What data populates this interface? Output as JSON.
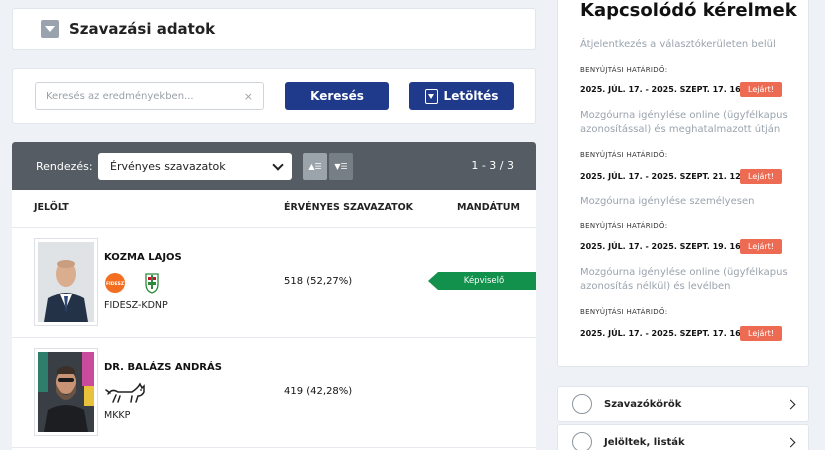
{
  "section": {
    "title": "Szavazási adatok"
  },
  "search": {
    "placeholder": "Keresés az eredményekben...",
    "clear": "×",
    "search_button": "Keresés",
    "download_button": "Letöltés"
  },
  "sort": {
    "label": "Rendezés:",
    "selected": "Érvényes szavazatok",
    "asc_glyph": "▲☰",
    "desc_glyph": "▼☰",
    "count": "1 - 3 / 3"
  },
  "table": {
    "headers": {
      "candidate": "JELÖLT",
      "votes": "ÉRVÉNYES SZAVAZATOK",
      "mandate": "MANDÁTUM"
    },
    "rows": [
      {
        "name": "KOZMA LAJOS",
        "party": "FIDESZ-KDNP",
        "party_logo_text": "FIDESZ",
        "votes": "518 (52,27%)",
        "mandate": "Képviselő"
      },
      {
        "name": "DR. BALÁZS ANDRÁS",
        "party": "MKKP",
        "votes": "419 (42,28%)"
      }
    ]
  },
  "related": {
    "title": "Kapcsolódó kérelmek",
    "items": [
      {
        "title": "Átjelentkezés a választókerületen belül",
        "deadline_label": "BENYÚJTÁSI HATÁRIDŐ:",
        "deadline": "2025. JÚL. 17. - 2025. SZEPT. 17. 16:00",
        "status": "Lejárt!"
      },
      {
        "title": "Mozgóurna igénylése online (ügyfélkapus azonosítással) és meghatalmazott útján",
        "deadline_label": "BENYÚJTÁSI HATÁRIDŐ:",
        "deadline": "2025. JÚL. 17. - 2025. SZEPT. 21. 12:00",
        "status": "Lejárt!"
      },
      {
        "title": "Mozgóurna igénylése személyesen",
        "deadline_label": "BENYÚJTÁSI HATÁRIDŐ:",
        "deadline": "2025. JÚL. 17. - 2025. SZEPT. 19. 16:00",
        "status": "Lejárt!"
      },
      {
        "title": "Mozgóurna igénylése online (ügyfélkapus azonosítás nélkül) és levélben",
        "deadline_label": "BENYÚJTÁSI HATÁRIDŐ:",
        "deadline": "2025. JÚL. 17. - 2025. SZEPT. 17. 16:00",
        "status": "Lejárt!"
      }
    ]
  },
  "links": [
    {
      "label": "Szavazókörök",
      "icon": "map-icon"
    },
    {
      "label": "Jelöltek, listák",
      "icon": "person-search-icon"
    }
  ],
  "colors": {
    "primary": "#1f3a8a",
    "elected": "#11914b",
    "expired": "#ee6b53",
    "bar": "#555c63"
  }
}
